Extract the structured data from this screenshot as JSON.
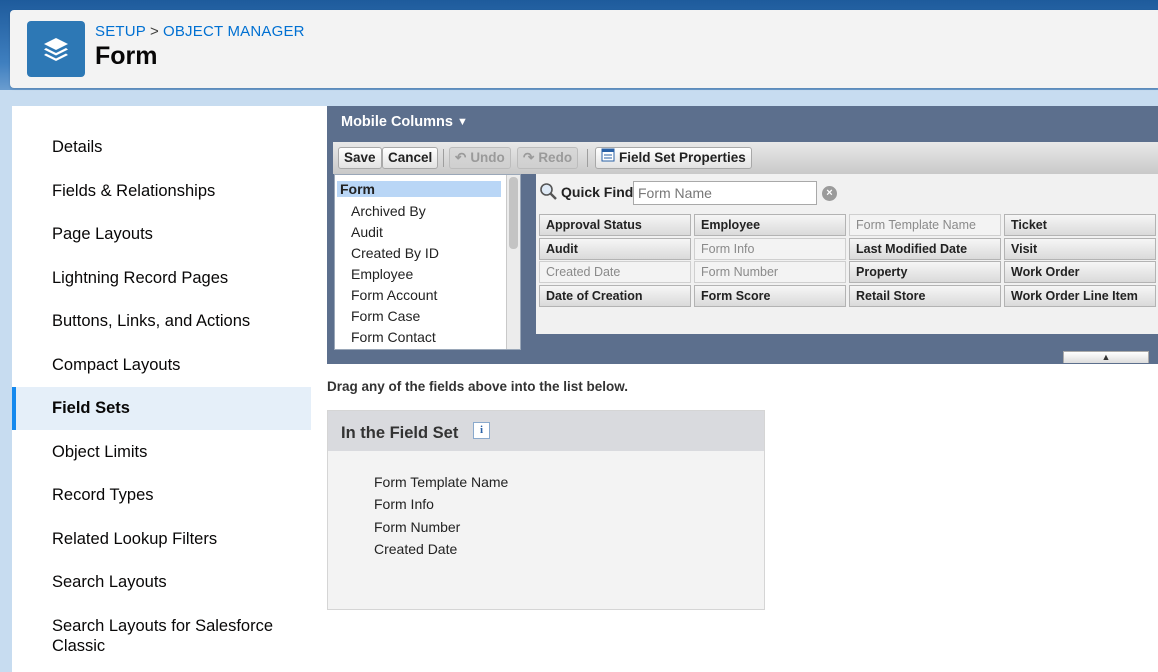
{
  "header": {
    "breadcrumb": [
      "SETUP",
      "OBJECT MANAGER"
    ],
    "breadcrumb_sep": ">",
    "title": "Form",
    "icon": "layers-icon"
  },
  "sidebar": {
    "items": [
      {
        "label": "Details"
      },
      {
        "label": "Fields & Relationships"
      },
      {
        "label": "Page Layouts"
      },
      {
        "label": "Lightning Record Pages"
      },
      {
        "label": "Buttons, Links, and Actions"
      },
      {
        "label": "Compact Layouts"
      },
      {
        "label": "Field Sets",
        "active": true
      },
      {
        "label": "Object Limits"
      },
      {
        "label": "Record Types"
      },
      {
        "label": "Related Lookup Filters"
      },
      {
        "label": "Search Layouts"
      },
      {
        "label": "Search Layouts for Salesforce Classic"
      }
    ]
  },
  "editor": {
    "title": "Mobile Columns",
    "toolbar": {
      "save": "Save",
      "cancel": "Cancel",
      "undo": "Undo",
      "redo": "Redo",
      "properties": "Field Set Properties"
    },
    "field_list": {
      "header": "Form",
      "items": [
        "Archived By",
        "Audit",
        "Created By ID",
        "Employee",
        "Form Account",
        "Form Case",
        "Form Contact"
      ]
    },
    "quick_find": {
      "label": "Quick Find",
      "placeholder": "Form Name"
    },
    "fields": [
      [
        "Approval Status",
        "Employee",
        "Form Template Name",
        "Ticket"
      ],
      [
        "Audit",
        "Form Info",
        "Last Modified Date",
        "Visit"
      ],
      [
        "Created Date",
        "Form Number",
        "Property",
        "Work Order"
      ],
      [
        "Date of Creation",
        "Form Score",
        "Retail Store",
        "Work Order Line Item"
      ]
    ],
    "used_fields": [
      "Form Template Name",
      "Form Info",
      "Form Number",
      "Created Date"
    ]
  },
  "drag_hint": "Drag any of the fields above into the list below.",
  "field_set": {
    "title": "In the Field Set",
    "info": "i",
    "items": [
      "Form Template Name",
      "Form Info",
      "Form Number",
      "Created Date"
    ]
  },
  "colors": {
    "accent": "#0070d2",
    "editor_bg": "#5c6f8d",
    "active_bar": "#1589ee"
  }
}
